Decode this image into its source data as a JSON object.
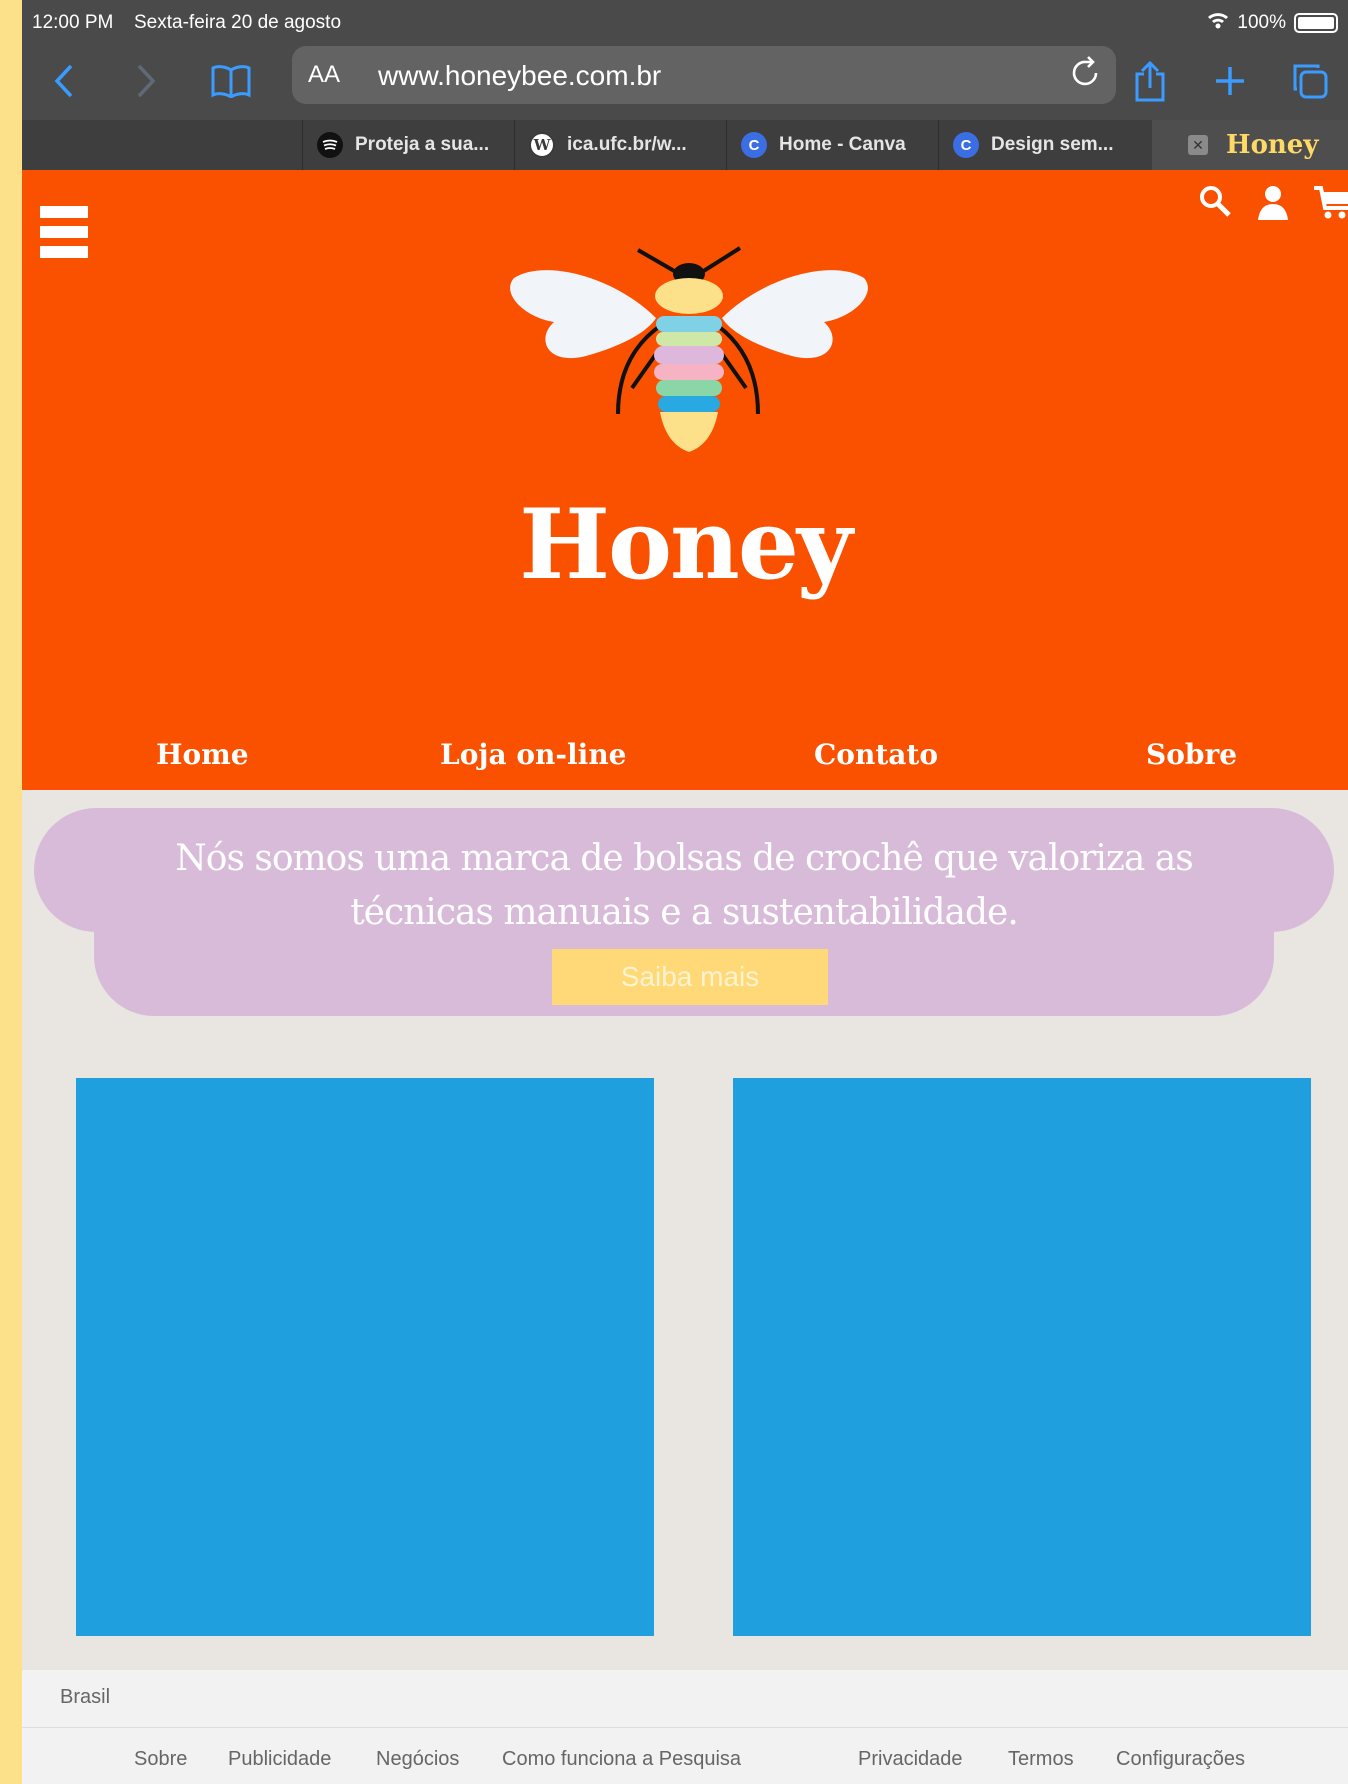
{
  "status": {
    "time": "12:00 PM",
    "date": "Sexta-feira 20 de agosto",
    "battery": "100%"
  },
  "browser": {
    "text_size": "AA",
    "url": "www.honeybee.com.br",
    "tabs": [
      {
        "label": "Proteja a sua..."
      },
      {
        "label": "ica.ufc.br/w..."
      },
      {
        "label": "Home - Canva"
      },
      {
        "label": "Design sem..."
      }
    ],
    "active_tab": "Honey"
  },
  "site": {
    "brand": "Honey",
    "nav": [
      "Home",
      "Loja on-line",
      "Contato",
      "Sobre"
    ],
    "tagline_1": "Nós somos uma marca de bolsas de crochê que valoriza as",
    "tagline_2": "técnicas manuais e a sustentabilidade.",
    "cta": "Saiba mais",
    "colors": {
      "hero": "#fa5100",
      "banner": "#d7bbd8",
      "cta": "#ffd978",
      "card": "#1f9fdd"
    }
  },
  "footer": {
    "country": "Brasil",
    "links_left": [
      "Sobre",
      "Publicidade",
      "Negócios",
      "Como funciona a Pesquisa"
    ],
    "links_right": [
      "Privacidade",
      "Termos",
      "Configurações"
    ]
  }
}
